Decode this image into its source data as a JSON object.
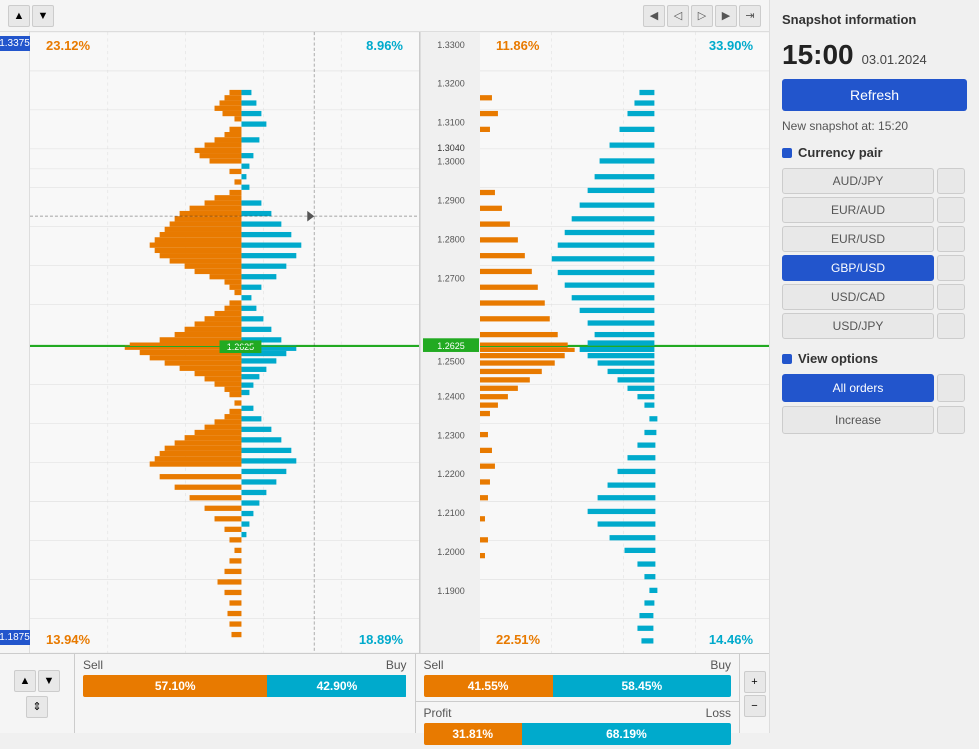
{
  "nav": {
    "prev_prev": "«",
    "prev": "‹",
    "next": "›",
    "next_next": "»",
    "last": "⇥",
    "up": "▲",
    "down": "▼"
  },
  "chart": {
    "price_top": "1.3375",
    "price_bottom": "1.1875",
    "current_price": "1.2625",
    "price_ticks": [
      "1.3300",
      "1.3200",
      "1.3100",
      "1.3040",
      "1.3000",
      "1.2900",
      "1.2800",
      "1.2700",
      "1.2625",
      "1.2500",
      "1.2400",
      "1.2300",
      "1.2200",
      "1.2100",
      "1.2000",
      "1.1900"
    ],
    "left_panel": {
      "pct_top_left": "23.12%",
      "pct_top_right": "8.96%",
      "pct_bottom_left": "13.94%",
      "pct_bottom_right": "18.89%"
    },
    "right_panel": {
      "pct_top_left": "11.86%",
      "pct_top_right": "33.90%",
      "pct_bottom_left": "22.51%",
      "pct_bottom_right": "14.46%"
    }
  },
  "bottom_bars": {
    "left": {
      "sell_label": "Sell",
      "buy_label": "Buy",
      "sell_pct": "57.10%",
      "buy_pct": "42.90%",
      "sell_width": 57,
      "buy_width": 43
    },
    "right": {
      "sell_label": "Sell",
      "buy_label": "Buy",
      "sell_pct": "41.55%",
      "buy_pct": "58.45%",
      "sell_width": 42,
      "buy_width": 58,
      "profit_label": "Profit",
      "loss_label": "Loss",
      "profit_pct": "31.81%",
      "loss_pct": "68.19%",
      "profit_width": 32,
      "loss_width": 68
    }
  },
  "panel": {
    "snapshot_title": "Snapshot information",
    "time": "15:00",
    "date": "03.01.2024",
    "refresh_label": "Refresh",
    "new_snapshot": "New snapshot at: 15:20",
    "currency_pair_label": "Currency pair",
    "currencies": [
      {
        "id": "AUD/JPY",
        "label": "AUD/JPY",
        "active": false
      },
      {
        "id": "EUR/AUD",
        "label": "EUR/AUD",
        "active": false
      },
      {
        "id": "EUR/USD",
        "label": "EUR/USD",
        "active": false
      },
      {
        "id": "GBP/USD",
        "label": "GBP/USD",
        "active": true
      },
      {
        "id": "USD/CAD",
        "label": "USD/CAD",
        "active": false
      },
      {
        "id": "USD/JPY",
        "label": "USD/JPY",
        "active": false
      }
    ],
    "view_options_label": "View options",
    "view_options": [
      {
        "id": "all_orders",
        "label": "All orders",
        "active": true
      },
      {
        "id": "increase",
        "label": "Increase",
        "active": false
      }
    ]
  }
}
